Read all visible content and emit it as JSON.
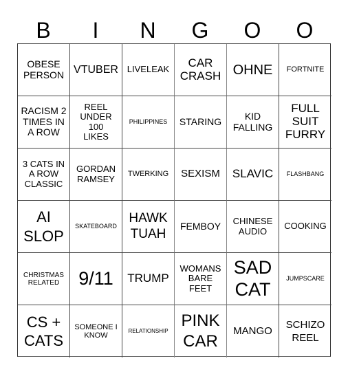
{
  "header": {
    "letters": [
      "B",
      "I",
      "N",
      "G",
      "O",
      "O"
    ]
  },
  "cells": [
    [
      "OBESE PERSON",
      "VTUBER",
      "LIVELEAK",
      "CAR CRASH",
      "OHNE",
      "FORTNITE"
    ],
    [
      "RACISM 2 TIMES IN A ROW",
      "REEL UNDER 100 LIKES",
      "PHILIPPINES",
      "STARING",
      "KID FALLING",
      "FULL SUIT FURRY"
    ],
    [
      "3 CATS IN A ROW CLASSIC",
      "GORDAN RAMSEY",
      "TWERKING",
      "SEXISM",
      "SLAVIC",
      "FLASHBANG"
    ],
    [
      "AI SLOP",
      "SKATEBOARD",
      "HAWK TUAH",
      "FEMBOY",
      "CHINESE AUDIO",
      "COOKING"
    ],
    [
      "CHRISTMAS RELATED",
      "9/11",
      "TRUMP",
      "WOMANS BARE FEET",
      "SAD CAT",
      "JUMPSCARE"
    ],
    [
      "CS + CATS",
      "SOMEONE I KNOW",
      "RELATIONSHIP",
      "PINK CAR",
      "MANGO",
      "SCHIZO REEL"
    ]
  ]
}
